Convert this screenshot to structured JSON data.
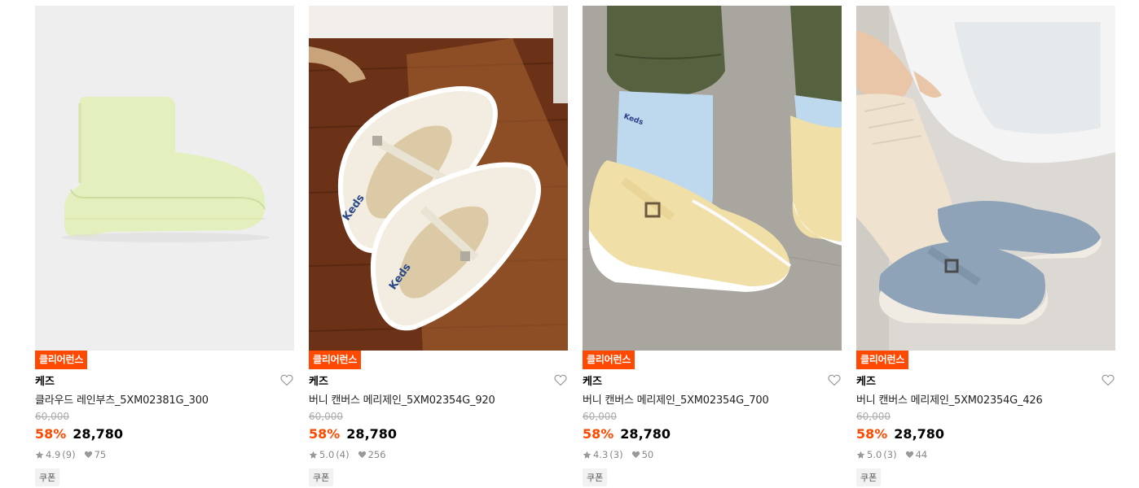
{
  "products": [
    {
      "badge": "클리어런스",
      "brand": "케즈",
      "name": "클라우드 레인부츠_5XM02381G_300",
      "original_price": "60,000",
      "discount": "58%",
      "price": "28,780",
      "rating": "4.9",
      "review_count": "(9)",
      "likes": "75",
      "coupon": "쿠폰"
    },
    {
      "badge": "클리어런스",
      "brand": "케즈",
      "name": "버니 캔버스 메리제인_5XM02354G_920",
      "original_price": "60,000",
      "discount": "58%",
      "price": "28,780",
      "rating": "5.0",
      "review_count": "(4)",
      "likes": "256",
      "coupon": "쿠폰"
    },
    {
      "badge": "클리어런스",
      "brand": "케즈",
      "name": "버니 캔버스 메리제인_5XM02354G_700",
      "original_price": "60,000",
      "discount": "58%",
      "price": "28,780",
      "rating": "4.3",
      "review_count": "(3)",
      "likes": "50",
      "coupon": "쿠폰"
    },
    {
      "badge": "클리어런스",
      "brand": "케즈",
      "name": "버니 캔버스 메리제인_5XM02354G_426",
      "original_price": "60,000",
      "discount": "58%",
      "price": "28,780",
      "rating": "5.0",
      "review_count": "(3)",
      "likes": "44",
      "coupon": "쿠폰"
    }
  ],
  "colors": {
    "accent": "#ff4800",
    "strike": "#aaaaaa",
    "meta": "#888888"
  },
  "image_text": {
    "shoe_logo": "Keds",
    "sock_logo": "Keds"
  }
}
